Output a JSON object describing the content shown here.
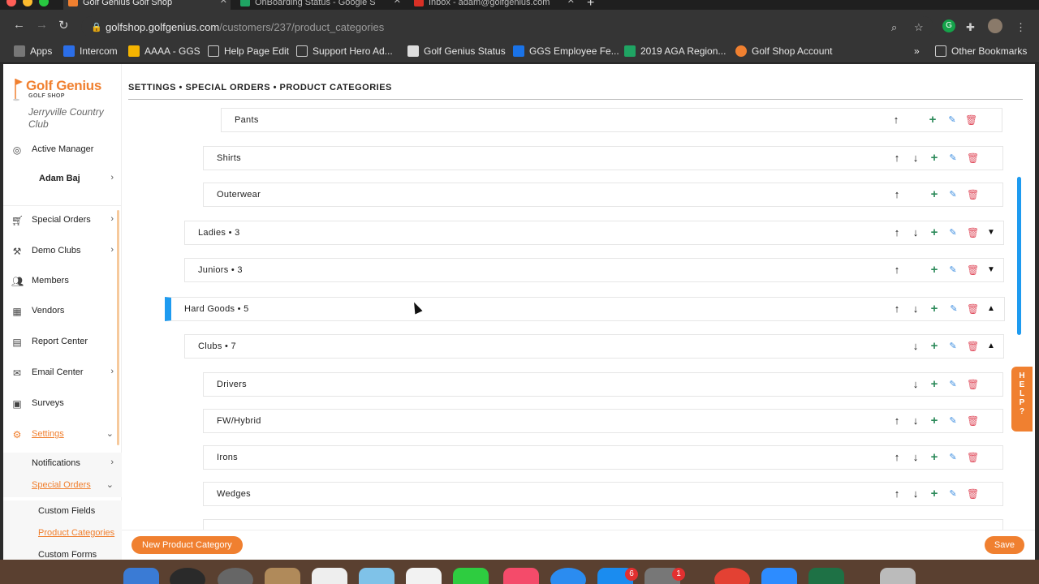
{
  "browser": {
    "tabs": [
      {
        "title": "Golf Genius Golf Shop",
        "active": true
      },
      {
        "title": "OnBoarding Status - Google S",
        "active": false
      },
      {
        "title": "Inbox - adam@golfgenius.com",
        "active": false
      }
    ],
    "url_host": "golfshop.golfgenius.com",
    "url_path": "/customers/237/product_categories",
    "bookmarks": [
      "Apps",
      "Intercom",
      "AAAA - GGS",
      "Help Page Edit",
      "Support Hero Ad...",
      "Golf Genius Status",
      "GGS Employee Fe...",
      "2019 AGA Region...",
      "Golf Shop Account"
    ],
    "bookmarks_overflow": "»",
    "other_bookmarks": "Other Bookmarks"
  },
  "sidebar": {
    "logo_name": "Golf Genius",
    "logo_sub": "GOLF SHOP",
    "club_name": "Jerryville Country Club",
    "active_manager": "Active Manager",
    "user_name": "Adam Baj",
    "items": [
      {
        "label": "Special Orders",
        "icon": "cart-icon",
        "chevron": "›"
      },
      {
        "label": "Demo Clubs",
        "icon": "golf-clubs-icon",
        "chevron": "›"
      },
      {
        "label": "Members",
        "icon": "members-icon",
        "chevron": ""
      },
      {
        "label": "Vendors",
        "icon": "vendors-icon",
        "chevron": ""
      },
      {
        "label": "Report Center",
        "icon": "report-icon",
        "chevron": ""
      },
      {
        "label": "Email Center",
        "icon": "email-icon",
        "chevron": "›"
      },
      {
        "label": "Surveys",
        "icon": "survey-icon",
        "chevron": ""
      },
      {
        "label": "Settings",
        "icon": "settings-icon",
        "chevron": "⌄"
      }
    ],
    "sub_items": [
      {
        "label": "Notifications",
        "chevron": "›"
      },
      {
        "label": "Special Orders",
        "chevron": "⌄"
      }
    ],
    "sub_sub_items": [
      "Custom Fields",
      "Product Categories",
      "Custom Forms"
    ]
  },
  "main": {
    "title": "SETTINGS • SPECIAL ORDERS • PRODUCT CATEGORIES",
    "categories": [
      {
        "label": "Pants"
      },
      {
        "label": "Shirts"
      },
      {
        "label": "Outerwear"
      },
      {
        "label": "Ladies • 3"
      },
      {
        "label": "Juniors • 3"
      },
      {
        "label": "Hard Goods • 5"
      },
      {
        "label": "Clubs • 7"
      },
      {
        "label": "Drivers"
      },
      {
        "label": "FW/Hybrid"
      },
      {
        "label": "Irons"
      },
      {
        "label": "Wedges"
      }
    ],
    "new_button": "New Product Category",
    "save_button": "Save",
    "help_label": [
      "H",
      "E",
      "L",
      "P",
      "?"
    ]
  },
  "colors": {
    "accent": "#f08030",
    "selected": "#1e9bf0",
    "add": "#2c8a5a",
    "edit": "#3c8de0",
    "delete": "#e05060"
  },
  "dock_badges": [
    "6",
    "1"
  ]
}
